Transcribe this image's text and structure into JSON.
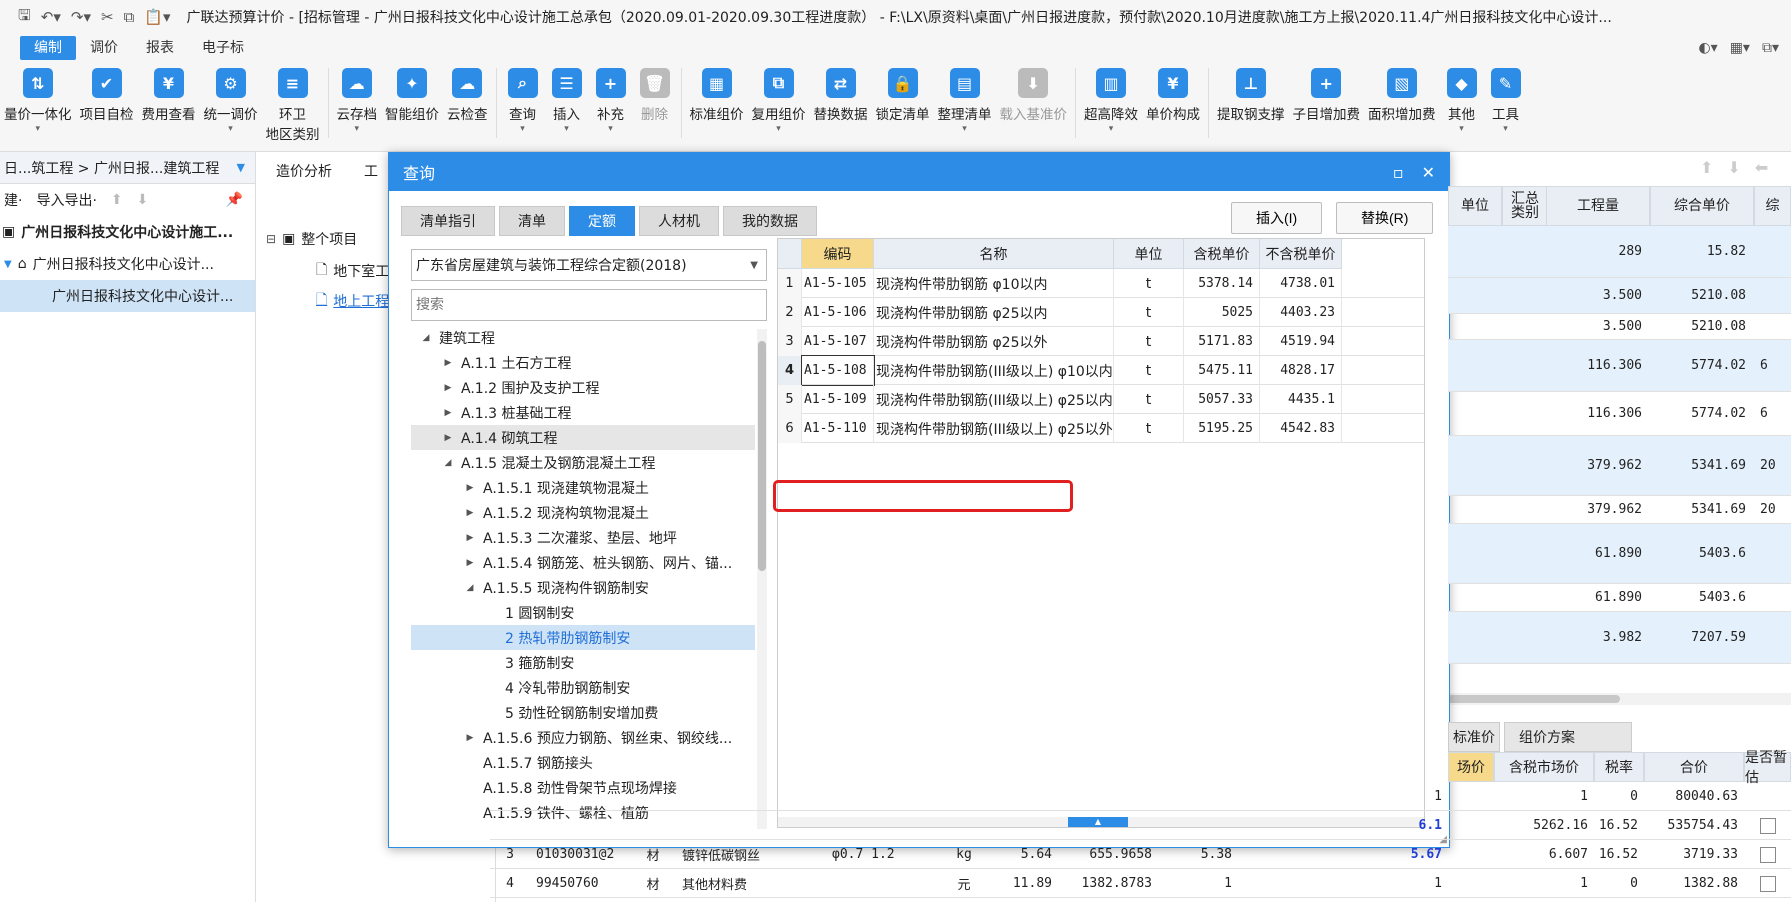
{
  "titlebar": {
    "title": "广联达预算计价 - [招标管理 - 广州日报科技文化中心设计施工总承包（2020.09.01-2020.09.30工程进度款） - F:\\LX\\原资料\\桌面\\广州日报进度款，预付款\\2020.10月进度款\\施工方上报\\2020.11.4广州日报科技文化中心设计..."
  },
  "menubar": {
    "items": [
      "编制",
      "调价",
      "报表",
      "电子标"
    ],
    "active": "编制"
  },
  "ribbon": {
    "buttons": [
      {
        "label": "量价一体化",
        "icon": "integrate-icon",
        "glyph": "⇅",
        "disabled": false,
        "dropdown": true
      },
      {
        "label": "项目自检",
        "icon": "check-icon",
        "glyph": "✔",
        "disabled": false,
        "dropdown": false
      },
      {
        "label": "费用查看",
        "icon": "fee-view-icon",
        "glyph": "¥",
        "disabled": false,
        "dropdown": false
      },
      {
        "label": "统一调价",
        "icon": "adjust-price-icon",
        "glyph": "⚙",
        "disabled": false,
        "dropdown": true
      },
      {
        "label": "环卫\n地区类别",
        "icon": "sanitation-icon",
        "glyph": "≡",
        "disabled": false,
        "dropdown": false
      },
      {
        "label": "云存档",
        "icon": "cloud-save-icon",
        "glyph": "☁",
        "disabled": false,
        "dropdown": true
      },
      {
        "label": "智能组价",
        "icon": "smart-price-icon",
        "glyph": "✦",
        "disabled": false,
        "dropdown": false
      },
      {
        "label": "云检查",
        "icon": "cloud-check-icon",
        "glyph": "☁",
        "disabled": false,
        "dropdown": false
      },
      {
        "label": "查询",
        "icon": "query-icon",
        "glyph": "⌕",
        "disabled": false,
        "dropdown": true
      },
      {
        "label": "插入",
        "icon": "insert-icon",
        "glyph": "☰",
        "disabled": false,
        "dropdown": true
      },
      {
        "label": "补充",
        "icon": "supplement-icon",
        "glyph": "+",
        "disabled": false,
        "dropdown": true
      },
      {
        "label": "删除",
        "icon": "delete-icon",
        "glyph": "🗑",
        "disabled": true,
        "dropdown": false
      },
      {
        "label": "标准组价",
        "icon": "standard-price-icon",
        "glyph": "▦",
        "disabled": false,
        "dropdown": false
      },
      {
        "label": "复用组价",
        "icon": "reuse-price-icon",
        "glyph": "⧉",
        "disabled": false,
        "dropdown": true
      },
      {
        "label": "替换数据",
        "icon": "replace-data-icon",
        "glyph": "⇄",
        "disabled": false,
        "dropdown": false
      },
      {
        "label": "锁定清单",
        "icon": "lock-icon",
        "glyph": "🔒",
        "disabled": false,
        "dropdown": false
      },
      {
        "label": "整理清单",
        "icon": "organize-icon",
        "glyph": "▤",
        "disabled": false,
        "dropdown": true
      },
      {
        "label": "载入基准价",
        "icon": "load-base-icon",
        "glyph": "⬇",
        "disabled": true,
        "dropdown": false
      },
      {
        "label": "超高降效",
        "icon": "high-rise-icon",
        "glyph": "▥",
        "disabled": false,
        "dropdown": true
      },
      {
        "label": "单价构成",
        "icon": "unit-price-icon",
        "glyph": "¥",
        "disabled": false,
        "dropdown": false
      },
      {
        "label": "提取钢支撑",
        "icon": "steel-support-icon",
        "glyph": "⊥",
        "disabled": false,
        "dropdown": false
      },
      {
        "label": "子目增加费",
        "icon": "sub-item-fee-icon",
        "glyph": "+",
        "disabled": false,
        "dropdown": false
      },
      {
        "label": "面积增加费",
        "icon": "area-fee-icon",
        "glyph": "▧",
        "disabled": false,
        "dropdown": false
      },
      {
        "label": "其他",
        "icon": "other-icon",
        "glyph": "◆",
        "disabled": false,
        "dropdown": true
      },
      {
        "label": "工具",
        "icon": "tools-icon",
        "glyph": "✎",
        "disabled": false,
        "dropdown": true
      }
    ]
  },
  "leftpanel": {
    "breadcrumb": "日...筑工程 > 广州日报...建筑工程",
    "toolbar": [
      "建·",
      "导入导出·"
    ],
    "nodes": [
      {
        "label": "广州日报科技文化中心设计施工...",
        "bold": true,
        "selected": false
      },
      {
        "label": "广州日报科技文化中心设计...",
        "bold": false,
        "selected": false
      },
      {
        "label": "广州日报科技文化中心设计...",
        "bold": false,
        "selected": true
      }
    ]
  },
  "centerarea": {
    "tabs": [
      "造价分析",
      "工"
    ],
    "tree": [
      {
        "label": "整个项目",
        "icon": "project-icon"
      },
      {
        "label": "地下室工",
        "icon": "file-icon"
      },
      {
        "label": "地上工程",
        "icon": "file-icon"
      }
    ]
  },
  "bggrid": {
    "headers": [
      "单位",
      "汇总\n类别",
      "工程量",
      "综合单价",
      "综"
    ],
    "rows": [
      {
        "qty": "289",
        "price": "15.82",
        "extra": "",
        "blue": true,
        "h": 52
      },
      {
        "qty": "3.500",
        "price": "5210.08",
        "extra": "",
        "blue": true,
        "h": 36
      },
      {
        "qty": "3.500",
        "price": "5210.08",
        "extra": "",
        "blue": false,
        "h": 26
      },
      {
        "qty": "116.306",
        "price": "5774.02",
        "extra": "6",
        "blue": true,
        "h": 52
      },
      {
        "qty": "116.306",
        "price": "5774.02",
        "extra": "6",
        "blue": false,
        "h": 44
      },
      {
        "qty": "379.962",
        "price": "5341.69",
        "extra": "20",
        "blue": true,
        "h": 60
      },
      {
        "qty": "379.962",
        "price": "5341.69",
        "extra": "20",
        "blue": false,
        "h": 28
      },
      {
        "qty": "61.890",
        "price": "5403.6",
        "extra": "",
        "blue": true,
        "h": 60
      },
      {
        "qty": "61.890",
        "price": "5403.6",
        "extra": "",
        "blue": false,
        "h": 28
      },
      {
        "qty": "3.982",
        "price": "7207.59",
        "extra": "",
        "blue": true,
        "h": 52
      }
    ]
  },
  "bottom": {
    "tabs": [
      "标准价",
      "组价方案"
    ],
    "headers": [
      "场价",
      "含税市场价",
      "税率",
      "合价",
      "是否暂估"
    ],
    "rows": [
      {
        "no": "",
        "code": "",
        "type": "",
        "name": "",
        "spec": "",
        "unit": "",
        "a": "",
        "b": "",
        "c": "",
        "market": "1",
        "taxmarket": "1",
        "rate": "0",
        "total": "80040.63",
        "check": false
      },
      {
        "no": "",
        "code": "",
        "type": "",
        "name": "",
        "spec": "",
        "unit": "",
        "a": "",
        "b": "",
        "c": "",
        "market": "6.1",
        "taxmarket": "5262.16",
        "rate": "16.52",
        "total": "535754.43",
        "check": true
      },
      {
        "no": "3",
        "code": "01030031@2",
        "type": "材",
        "name": "镀锌低碳钢丝",
        "spec": "φ0.7 1.2",
        "unit": "kg",
        "a": "5.64",
        "b": "655.9658",
        "c": "5.38",
        "market": "5.67",
        "taxmarket": "6.607",
        "rate": "16.52",
        "total": "3719.33",
        "check": true
      },
      {
        "no": "4",
        "code": "99450760",
        "type": "材",
        "name": "其他材料费",
        "spec": "",
        "unit": "元",
        "a": "11.89",
        "b": "1382.8783",
        "c": "1",
        "market": "1",
        "taxmarket": "1",
        "rate": "0",
        "total": "1382.88",
        "check": true
      }
    ]
  },
  "dialog": {
    "title": "查询",
    "tabs": [
      "清单指引",
      "清单",
      "定额",
      "人材机",
      "我的数据"
    ],
    "active_tab": "定额",
    "insert_label": "插入(I)",
    "replace_label": "替换(R)",
    "quota_library": "广东省房屋建筑与装饰工程综合定额(2018)",
    "search_placeholder": "搜索",
    "tree": [
      {
        "label": "建筑工程",
        "level": 0,
        "tri": "◢",
        "state": ""
      },
      {
        "label": "A.1.1 土石方工程",
        "level": 1,
        "tri": "▶",
        "state": ""
      },
      {
        "label": "A.1.2 围护及支护工程",
        "level": 1,
        "tri": "▶",
        "state": ""
      },
      {
        "label": "A.1.3 桩基础工程",
        "level": 1,
        "tri": "▶",
        "state": ""
      },
      {
        "label": "A.1.4 砌筑工程",
        "level": 1,
        "tri": "▶",
        "state": "hov"
      },
      {
        "label": "A.1.5 混凝土及钢筋混凝土工程",
        "level": 1,
        "tri": "◢",
        "state": ""
      },
      {
        "label": "A.1.5.1 现浇建筑物混凝土",
        "level": 2,
        "tri": "▶",
        "state": ""
      },
      {
        "label": "A.1.5.2 现浇构筑物混凝土",
        "level": 2,
        "tri": "▶",
        "state": ""
      },
      {
        "label": "A.1.5.3 二次灌浆、垫层、地坪",
        "level": 2,
        "tri": "▶",
        "state": ""
      },
      {
        "label": "A.1.5.4 钢筋笼、桩头钢筋、网片、锚...",
        "level": 2,
        "tri": "▶",
        "state": ""
      },
      {
        "label": "A.1.5.5 现浇构件钢筋制安",
        "level": 2,
        "tri": "◢",
        "state": ""
      },
      {
        "label": "1 圆钢制安",
        "level": 3,
        "tri": "",
        "state": ""
      },
      {
        "label": "2 热轧带肋钢筋制安",
        "level": 3,
        "tri": "",
        "state": "sel"
      },
      {
        "label": "3 箍筋制安",
        "level": 3,
        "tri": "",
        "state": ""
      },
      {
        "label": "4 冷轧带肋钢筋制安",
        "level": 3,
        "tri": "",
        "state": ""
      },
      {
        "label": "5 劲性砼钢筋制安增加费",
        "level": 3,
        "tri": "",
        "state": ""
      },
      {
        "label": "A.1.5.6 预应力钢筋、钢丝束、钢绞线...",
        "level": 2,
        "tri": "▶",
        "state": ""
      },
      {
        "label": "A.1.5.7 钢筋接头",
        "level": 2,
        "tri": "",
        "state": ""
      },
      {
        "label": "A.1.5.8 劲性骨架节点现场焊接",
        "level": 2,
        "tri": "",
        "state": ""
      },
      {
        "label": "A.1.5.9 铁件、螺栓、植筋",
        "level": 2,
        "tri": "",
        "state": ""
      }
    ],
    "table": {
      "headers": [
        "编码",
        "名称",
        "单位",
        "含税单价",
        "不含税单价"
      ],
      "rows": [
        {
          "no": "1",
          "code": "A1-5-105",
          "name": "现浇构件带肋钢筋 φ10以内",
          "unit": "t",
          "tax": "5378.14",
          "notax": "4738.01"
        },
        {
          "no": "2",
          "code": "A1-5-106",
          "name": "现浇构件带肋钢筋 φ25以内",
          "unit": "t",
          "tax": "5025",
          "notax": "4403.23"
        },
        {
          "no": "3",
          "code": "A1-5-107",
          "name": "现浇构件带肋钢筋 φ25以外",
          "unit": "t",
          "tax": "5171.83",
          "notax": "4519.94"
        },
        {
          "no": "4",
          "code": "A1-5-108",
          "name": "现浇构件带肋钢筋(III级以上) φ10以内",
          "unit": "t",
          "tax": "5475.11",
          "notax": "4828.17"
        },
        {
          "no": "5",
          "code": "A1-5-109",
          "name": "现浇构件带肋钢筋(III级以上) φ25以内",
          "unit": "t",
          "tax": "5057.33",
          "notax": "4435.1"
        },
        {
          "no": "6",
          "code": "A1-5-110",
          "name": "现浇构件带肋钢筋(III级以上) φ25以外",
          "unit": "t",
          "tax": "5195.25",
          "notax": "4542.83"
        }
      ],
      "current_row": "4"
    }
  }
}
